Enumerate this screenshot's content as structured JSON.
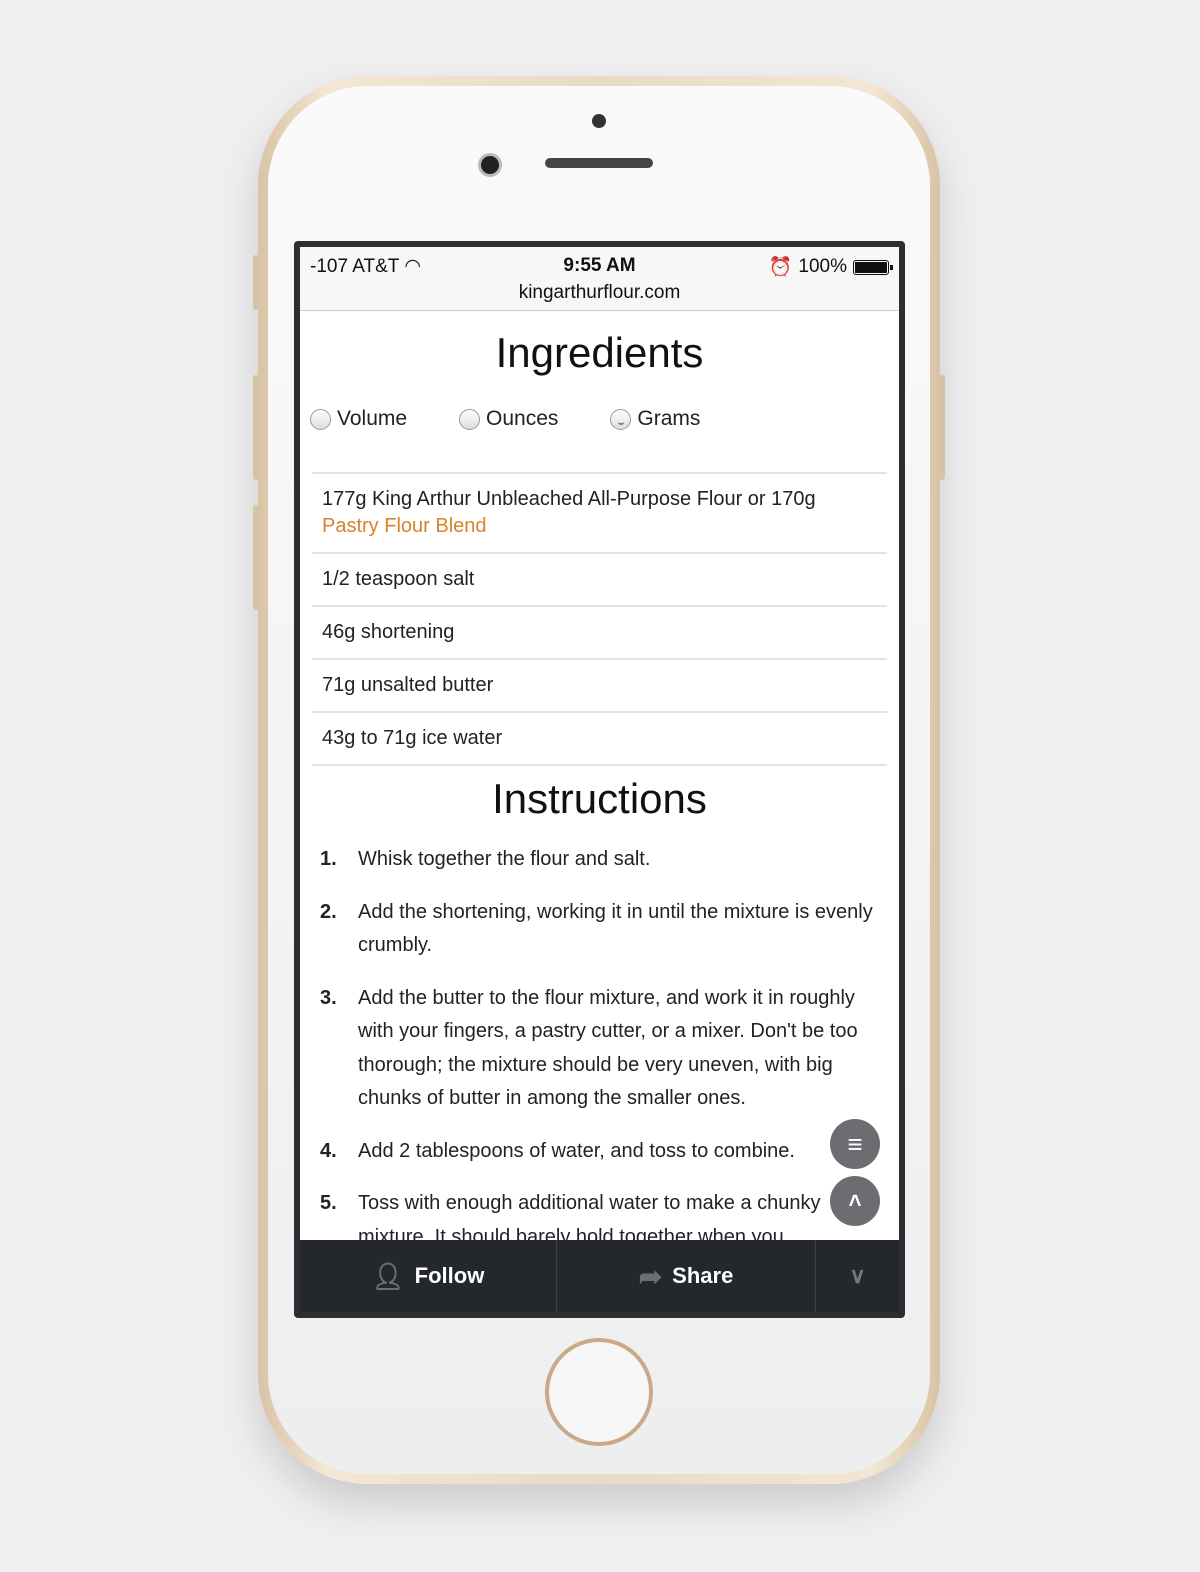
{
  "status": {
    "carrier": "-107 AT&T",
    "time": "9:55 AM",
    "battery": "100%",
    "battery_level": 1.0,
    "url": "kingarthurflour.com"
  },
  "ingredients": {
    "title": "Ingredients",
    "units": [
      {
        "label": "Volume",
        "selected": false
      },
      {
        "label": "Ounces",
        "selected": false
      },
      {
        "label": "Grams",
        "selected": true
      }
    ],
    "items": [
      "177g King Arthur Unbleached All-Purpose Flour or 170g",
      "1/2 teaspoon salt",
      "46g shortening",
      "71g unsalted butter",
      "43g to 71g ice water"
    ],
    "link": "Pastry Flour Blend"
  },
  "instructions": {
    "title": "Instructions",
    "steps": [
      {
        "n": "1.",
        "text": "Whisk together the flour and salt."
      },
      {
        "n": "2.",
        "text": "Add the shortening, working it in until the mixture is evenly crumbly."
      },
      {
        "n": "3.",
        "text": "Add the butter to the flour mixture, and work it in roughly with your fingers, a pastry cutter, or a mixer. Don't be too thorough; the mixture should be very uneven, with big chunks of butter in among the smaller ones."
      },
      {
        "n": "4.",
        "text": "Add 2 tablespoons of water, and toss to combine."
      },
      {
        "n": "5.",
        "text": "Toss with enough additional water to make a chunky mixture. It should barely hold together when you"
      }
    ]
  },
  "toolbar": {
    "follow": "Follow",
    "share": "Share"
  },
  "colors": {
    "link": "#d9822b",
    "toolbar": "#24282c"
  }
}
